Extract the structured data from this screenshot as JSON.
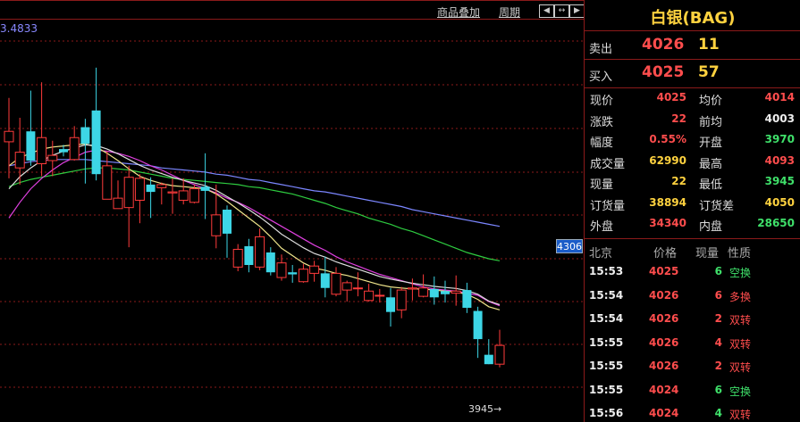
{
  "toolbar": {
    "overlay_label": "商品叠加",
    "period_label": "周期"
  },
  "chart": {
    "y_max_label": "3.4833",
    "current_price_tag": "4306",
    "low_marker_label": "3945→"
  },
  "chart_data": {
    "type": "candlestick",
    "candles": [
      [
        4103,
        4113,
        4145,
        4068
      ],
      [
        4078,
        4093,
        4126,
        4062
      ],
      [
        4113,
        4085,
        4152,
        4080
      ],
      [
        4082,
        4107,
        4160,
        4070
      ],
      [
        4085,
        4090,
        4104,
        4070
      ],
      [
        4096,
        4093,
        4100,
        4089
      ],
      [
        4086,
        4107,
        4118,
        4085
      ],
      [
        4117,
        4101,
        4125,
        4063
      ],
      [
        4133,
        4072,
        4174,
        4066
      ],
      [
        4048,
        4080,
        4094,
        4048
      ],
      [
        4039,
        4049,
        4066,
        4039
      ],
      [
        4040,
        4069,
        4080,
        4002
      ],
      [
        4047,
        4068,
        4072,
        4025
      ],
      [
        4062,
        4055,
        4069,
        4030
      ],
      [
        4059,
        4062,
        4064,
        4043
      ],
      [
        4054,
        4055,
        4068,
        4034
      ],
      [
        4047,
        4056,
        4068,
        4043
      ],
      [
        4045,
        4058,
        4062,
        4044
      ],
      [
        4060,
        4056,
        4092,
        4029
      ],
      [
        4013,
        4033,
        4062,
        4001
      ],
      [
        4038,
        4015,
        4042,
        3992
      ],
      [
        3983,
        4000,
        4005,
        3979
      ],
      [
        4003,
        3985,
        4010,
        3978
      ],
      [
        3983,
        4012,
        4020,
        3980
      ],
      [
        3997,
        3978,
        4002,
        3975
      ],
      [
        3973,
        3987,
        3995,
        3970
      ],
      [
        3978,
        3976,
        3985,
        3968
      ],
      [
        3969,
        3981,
        3986,
        3968
      ],
      [
        3977,
        3984,
        3989,
        3969
      ],
      [
        3977,
        3963,
        3993,
        3954
      ],
      [
        3957,
        3977,
        3983,
        3955
      ],
      [
        3961,
        3968,
        3970,
        3950
      ],
      [
        3963,
        3963,
        3978,
        3955
      ],
      [
        3951,
        3960,
        3967,
        3950
      ],
      [
        3956,
        3956,
        3962,
        3949
      ],
      [
        3954,
        3940,
        3963,
        3926
      ],
      [
        3942,
        3961,
        3964,
        3934
      ],
      [
        3962,
        3963,
        3972,
        3951
      ],
      [
        3955,
        3963,
        3976,
        3954
      ],
      [
        3962,
        3954,
        3974,
        3947
      ],
      [
        3960,
        3957,
        3970,
        3949
      ],
      [
        3958,
        3960,
        3975,
        3946
      ],
      [
        3961,
        3944,
        3968,
        3939
      ],
      [
        3941,
        3914,
        3945,
        3896
      ],
      [
        3899,
        3890,
        3914,
        3890
      ],
      [
        3890,
        3908,
        3923,
        3887
      ]
    ],
    "ma_short": [
      4080,
      4088,
      4092,
      4096,
      4098,
      4099,
      4100,
      4101,
      4098,
      4092,
      4085,
      4077,
      4070,
      4066,
      4063,
      4061,
      4060,
      4059,
      4058,
      4053,
      4046,
      4038,
      4030,
      4022,
      4012,
      4001,
      3994,
      3987,
      3982,
      3980,
      3977,
      3975,
      3972,
      3969,
      3966,
      3964,
      3963,
      3962,
      3962,
      3961,
      3960,
      3959,
      3957,
      3952,
      3945,
      3942
    ],
    "ma_mid": [
      4030,
      4045,
      4058,
      4068,
      4076,
      4083,
      4088,
      4093,
      4095,
      4094,
      4092,
      4089,
      4085,
      4080,
      4076,
      4071,
      4066,
      4062,
      4058,
      4054,
      4049,
      4045,
      4040,
      4034,
      4028,
      4022,
      4016,
      4010,
      4004,
      3999,
      3993,
      3988,
      3984,
      3980,
      3976,
      3973,
      3970,
      3967,
      3964,
      3962,
      3961,
      3960,
      3958,
      3956,
      3950,
      3946
    ],
    "ma_long": [
      4060,
      4064,
      4067,
      4069,
      4071,
      4073,
      4075,
      4077,
      4078,
      4078,
      4077,
      4076,
      4074,
      4072,
      4070,
      4068,
      4067,
      4066,
      4065,
      4064,
      4063,
      4062,
      4060,
      4059,
      4057,
      4055,
      4053,
      4050,
      4047,
      4044,
      4040,
      4037,
      4034,
      4030,
      4027,
      4024,
      4020,
      4017,
      4013,
      4009,
      4005,
      4001,
      3997,
      3994,
      3991,
      3989
    ],
    "ma_xlong": [
      4080,
      4082,
      4084,
      4085,
      4086,
      4086,
      4086,
      4086,
      4085,
      4084,
      4083,
      4082,
      4081,
      4080,
      4078,
      4077,
      4076,
      4075,
      4074,
      4072,
      4071,
      4069,
      4067,
      4066,
      4064,
      4062,
      4060,
      4058,
      4056,
      4055,
      4053,
      4051,
      4049,
      4047,
      4045,
      4043,
      4041,
      4038,
      4036,
      4034,
      4032,
      4030,
      4028,
      4026,
      4024,
      4022
    ]
  },
  "quote": {
    "title": "白银(BAG)",
    "sell_label": "卖出",
    "sell_price": "4026",
    "sell_volume": "11",
    "buy_label": "买入",
    "buy_price": "4025",
    "buy_volume": "57",
    "stats": [
      {
        "l1": "现价",
        "v1": "4025",
        "c1": "red",
        "l2": "均价",
        "v2": "4014",
        "c2": "red"
      },
      {
        "l1": "涨跌",
        "v1": "22",
        "c1": "red",
        "l2": "前均",
        "v2": "4003",
        "c2": "white"
      },
      {
        "l1": "幅度",
        "v1": "0.55%",
        "c1": "red",
        "l2": "开盘",
        "v2": "3970",
        "c2": "green"
      },
      {
        "l1": "成交量",
        "v1": "62990",
        "c1": "yellow",
        "l2": "最高",
        "v2": "4093",
        "c2": "red"
      },
      {
        "l1": "现量",
        "v1": "22",
        "c1": "yellow",
        "l2": "最低",
        "v2": "3945",
        "c2": "green"
      },
      {
        "l1": "订货量",
        "v1": "38894",
        "c1": "yellow",
        "l2": "订货差",
        "v2": "4050",
        "c2": "yellow"
      },
      {
        "l1": "外盘",
        "v1": "34340",
        "c1": "red",
        "l2": "内盘",
        "v2": "28650",
        "c2": "green"
      }
    ]
  },
  "ticks": {
    "headers": [
      "北京",
      "价格",
      "现量",
      "性质"
    ],
    "rows": [
      {
        "time": "15:53",
        "price": "4025",
        "vol": "6",
        "vol_color": "green",
        "nature": "空换",
        "nature_color": "green"
      },
      {
        "time": "15:54",
        "price": "4026",
        "vol": "6",
        "vol_color": "red",
        "nature": "多换",
        "nature_color": "red"
      },
      {
        "time": "15:54",
        "price": "4026",
        "vol": "2",
        "vol_color": "red",
        "nature": "双转",
        "nature_color": "red"
      },
      {
        "time": "15:55",
        "price": "4026",
        "vol": "4",
        "vol_color": "red",
        "nature": "双转",
        "nature_color": "red"
      },
      {
        "time": "15:55",
        "price": "4026",
        "vol": "2",
        "vol_color": "red",
        "nature": "双转",
        "nature_color": "red"
      },
      {
        "time": "15:55",
        "price": "4024",
        "vol": "6",
        "vol_color": "green",
        "nature": "空换",
        "nature_color": "green"
      },
      {
        "time": "15:56",
        "price": "4024",
        "vol": "4",
        "vol_color": "green",
        "nature": "双转",
        "nature_color": "red"
      }
    ]
  }
}
